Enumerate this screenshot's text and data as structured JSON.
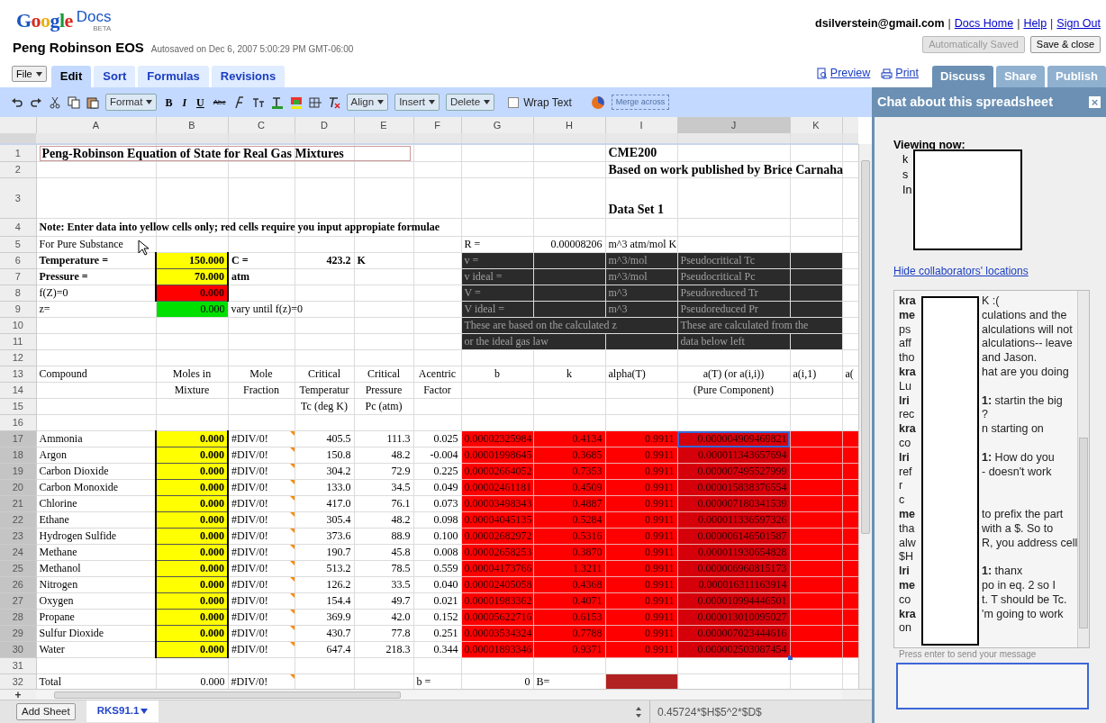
{
  "logo": {
    "wordmark": "Google",
    "product": "Docs",
    "badge": "BETA"
  },
  "document": {
    "title": "Peng Robinson EOS",
    "autosave": "Autosaved on Dec 6, 2007 5:00:29 PM GMT-06:00"
  },
  "account_bar": [
    {
      "text": "dsilverstein@gmail.com",
      "kind": "email"
    },
    {
      "text": "|",
      "kind": "separator"
    },
    {
      "text": "Docs Home",
      "kind": "link"
    },
    {
      "text": "|",
      "kind": "separator"
    },
    {
      "text": "Help",
      "kind": "link"
    },
    {
      "text": "|",
      "kind": "separator"
    },
    {
      "text": "Sign Out",
      "kind": "link"
    }
  ],
  "save_buttons": [
    {
      "label": "Automatically Saved",
      "disabled": true
    },
    {
      "label": "Save & close",
      "disabled": false
    }
  ],
  "file_menu": "File",
  "tabs": [
    {
      "label": "Edit",
      "selected": true
    },
    {
      "label": "Sort",
      "selected": false
    },
    {
      "label": "Formulas",
      "selected": false
    },
    {
      "label": "Revisions",
      "selected": false
    }
  ],
  "view_links": [
    {
      "label": "Preview"
    },
    {
      "label": "Print"
    }
  ],
  "panel_tabs": [
    {
      "label": "Discuss",
      "selected": true
    },
    {
      "label": "Share",
      "selected": false
    },
    {
      "label": "Publish",
      "selected": false
    }
  ],
  "toolbar": {
    "format": "Format",
    "bold": "B",
    "italic": "I",
    "underline": "U",
    "strikethrough": "Abc",
    "align": "Align",
    "insert": "Insert",
    "delete": "Delete",
    "wrap_text": {
      "label": "Wrap Text",
      "checked": false
    },
    "merge": {
      "label": "Merge across",
      "disabled": true
    }
  },
  "columns": [
    {
      "label": "A",
      "selected": false
    },
    {
      "label": "B",
      "selected": false
    },
    {
      "label": "C",
      "selected": false
    },
    {
      "label": "D",
      "selected": false
    },
    {
      "label": "E",
      "selected": false
    },
    {
      "label": "F",
      "selected": false
    },
    {
      "label": "G",
      "selected": false
    },
    {
      "label": "H",
      "selected": false
    },
    {
      "label": "I",
      "selected": false
    },
    {
      "label": "J",
      "selected": true
    },
    {
      "label": "K",
      "selected": false
    }
  ],
  "rows": [
    {
      "number": "1",
      "selected": false,
      "cells": {
        "A": {
          "text": "Peng-Robinson Equation of State for Real Gas Mixtures",
          "kind": "boxed_title"
        },
        "I": {
          "text": "CME200",
          "kind": "title"
        }
      }
    },
    {
      "number": "2",
      "selected": false,
      "cells": {
        "I": {
          "text": "Based on work published by Brice Carnaha",
          "kind": "title"
        }
      }
    },
    {
      "number": "3",
      "selected": false,
      "cells": {
        "I": {
          "text": "Data Set 1",
          "kind": "title"
        }
      }
    },
    {
      "number": "4",
      "selected": false,
      "cells": {
        "A": {
          "text": "Note: Enter data into yellow cells only; red cells require you input appropiate formulae",
          "kind": "bold"
        }
      }
    },
    {
      "number": "5",
      "selected": false,
      "cells": {
        "A": {
          "text": "For Pure Substance"
        },
        "G": {
          "text": "R ="
        },
        "H": {
          "text": "0.00008206"
        },
        "I": {
          "text": "m^3 atm/mol K"
        }
      }
    },
    {
      "number": "6",
      "selected": false,
      "cells": {
        "A": {
          "text": "Temperature =",
          "kind": "bold"
        },
        "B": {
          "text": "150.000",
          "kind": "input",
          "color": "#ffff00"
        },
        "C": {
          "text": "C =",
          "kind": "bold"
        },
        "D": {
          "text": "423.2",
          "kind": "bold"
        },
        "E": {
          "text": "K",
          "kind": "bold"
        },
        "G": {
          "text": "v =",
          "color": "#2b2b2b"
        },
        "H": {
          "color": "#2b2b2b"
        },
        "I": {
          "text": "m^3/mol",
          "color": "#2b2b2b"
        },
        "J": {
          "text": "Pseudocritical Tc",
          "color": "#2b2b2b"
        },
        "K": {
          "color": "#2b2b2b"
        }
      }
    },
    {
      "number": "7",
      "selected": false,
      "cells": {
        "A": {
          "text": "Pressure =",
          "kind": "bold"
        },
        "B": {
          "text": "70.000",
          "kind": "input",
          "color": "#ffff00"
        },
        "C": {
          "text": "atm",
          "kind": "bold"
        },
        "G": {
          "text": "v ideal =",
          "color": "#2b2b2b"
        },
        "H": {
          "color": "#2b2b2b"
        },
        "I": {
          "text": "m^3/mol",
          "color": "#2b2b2b"
        },
        "J": {
          "text": "Pseudocritical Pc",
          "color": "#2b2b2b"
        },
        "K": {
          "color": "#2b2b2b"
        }
      }
    },
    {
      "number": "8",
      "selected": false,
      "cells": {
        "A": {
          "text": "f(Z)=0"
        },
        "B": {
          "text": "0.000",
          "kind": "input",
          "color": "#ff0000"
        },
        "G": {
          "text": "V =",
          "color": "#2b2b2b"
        },
        "H": {
          "color": "#2b2b2b"
        },
        "I": {
          "text": "m^3",
          "color": "#2b2b2b"
        },
        "J": {
          "text": "Pseudoreduced Tr",
          "color": "#2b2b2b"
        },
        "K": {
          "color": "#2b2b2b"
        }
      }
    },
    {
      "number": "9",
      "selected": false,
      "cells": {
        "A": {
          "text": "z="
        },
        "B": {
          "text": "0.000",
          "color": "#00e000"
        },
        "C": {
          "text": "vary until f(z)=0"
        },
        "G": {
          "text": "V ideal =",
          "color": "#2b2b2b"
        },
        "H": {
          "color": "#2b2b2b"
        },
        "I": {
          "text": "m^3",
          "color": "#2b2b2b"
        },
        "J": {
          "text": "Pseudoreduced Pr",
          "color": "#2b2b2b"
        },
        "K": {
          "color": "#2b2b2b"
        }
      }
    },
    {
      "number": "10",
      "selected": false,
      "cells": {
        "G": {
          "text": "These are based on the calculated z",
          "color": "#2b2b2b"
        },
        "H": {
          "color": "#2b2b2b"
        },
        "I": {
          "color": "#2b2b2b"
        },
        "J": {
          "text": "These are calculated from the",
          "color": "#2b2b2b"
        },
        "K": {
          "color": "#2b2b2b"
        }
      }
    },
    {
      "number": "11",
      "selected": false,
      "cells": {
        "G": {
          "text": "or the ideal gas law",
          "color": "#2b2b2b"
        },
        "H": {
          "color": "#2b2b2b"
        },
        "I": {
          "color": "#2b2b2b"
        },
        "J": {
          "text": "data below left",
          "color": "#2b2b2b"
        },
        "K": {
          "color": "#2b2b2b"
        }
      }
    },
    {
      "number": "12",
      "selected": false,
      "cells": {}
    },
    {
      "number": "13",
      "selected": false,
      "cells": {
        "A": {
          "text": "Compound"
        },
        "B": {
          "text": "Moles in"
        },
        "C": {
          "text": "Mole"
        },
        "D": {
          "text": "Critical"
        },
        "E": {
          "text": "Critical"
        },
        "F": {
          "text": "Acentric"
        },
        "G": {
          "text": "b"
        },
        "H": {
          "text": "k"
        },
        "I": {
          "text": "alpha(T)"
        },
        "J": {
          "text": "a(T) (or a(i,i))"
        },
        "K": {
          "text": "a(i,1)"
        },
        "L": {
          "text": "a("
        }
      }
    },
    {
      "number": "14",
      "selected": false,
      "cells": {
        "B": {
          "text": "Mixture"
        },
        "C": {
          "text": "Fraction"
        },
        "D": {
          "text": "Temperatur"
        },
        "E": {
          "text": "Pressure"
        },
        "F": {
          "text": "Factor"
        },
        "J": {
          "text": "(Pure Component)"
        }
      }
    },
    {
      "number": "15",
      "selected": false,
      "cells": {
        "D": {
          "text": "Tc (deg K)"
        },
        "E": {
          "text": "Pc (atm)"
        }
      }
    },
    {
      "number": "16",
      "selected": false,
      "cells": {}
    },
    {
      "number": "17",
      "selected": true,
      "cells": {
        "A": {
          "text": "Ammonia"
        },
        "B": {
          "text": "0.000",
          "kind": "input",
          "color": "#ffff00"
        },
        "C": {
          "text": "#DIV/0!",
          "comment": true
        },
        "D": {
          "text": "405.5"
        },
        "E": {
          "text": "111.3"
        },
        "F": {
          "text": "0.025"
        },
        "G": {
          "text": "0.00002325984",
          "color": "#ff0000"
        },
        "H": {
          "text": "0.4134",
          "color": "#ff0000"
        },
        "I": {
          "text": "0.9911",
          "color": "#ff0000"
        },
        "J": {
          "text": "0.000004909469821",
          "color": "#ff0000"
        },
        "K": {
          "color": "#ff0000"
        },
        "L": {
          "color": "#ff0000"
        }
      }
    },
    {
      "number": "18",
      "selected": true,
      "cells": {
        "A": {
          "text": "Argon"
        },
        "B": {
          "text": "0.000",
          "kind": "input",
          "color": "#ffff00"
        },
        "C": {
          "text": "#DIV/0!",
          "comment": true
        },
        "D": {
          "text": "150.8"
        },
        "E": {
          "text": "48.2"
        },
        "F": {
          "text": "-0.004"
        },
        "G": {
          "text": "0.00001998645",
          "color": "#ff0000"
        },
        "H": {
          "text": "0.3685",
          "color": "#ff0000"
        },
        "I": {
          "text": "0.9911",
          "color": "#ff0000"
        },
        "J": {
          "text": "0.000011343657694",
          "color": "#ff0000"
        },
        "K": {
          "color": "#ff0000"
        },
        "L": {
          "color": "#ff0000"
        }
      }
    },
    {
      "number": "19",
      "selected": true,
      "cells": {
        "A": {
          "text": "Carbon Dioxide"
        },
        "B": {
          "text": "0.000",
          "kind": "input",
          "color": "#ffff00"
        },
        "C": {
          "text": "#DIV/0!",
          "comment": true
        },
        "D": {
          "text": "304.2"
        },
        "E": {
          "text": "72.9"
        },
        "F": {
          "text": "0.225"
        },
        "G": {
          "text": "0.00002664052",
          "color": "#ff0000"
        },
        "H": {
          "text": "0.7353",
          "color": "#ff0000"
        },
        "I": {
          "text": "0.9911",
          "color": "#ff0000"
        },
        "J": {
          "text": "0.000007495527999",
          "color": "#ff0000"
        },
        "K": {
          "color": "#ff0000"
        },
        "L": {
          "color": "#ff0000"
        }
      }
    },
    {
      "number": "20",
      "selected": true,
      "cells": {
        "A": {
          "text": "Carbon Monoxide"
        },
        "B": {
          "text": "0.000",
          "kind": "input",
          "color": "#ffff00"
        },
        "C": {
          "text": "#DIV/0!",
          "comment": true
        },
        "D": {
          "text": "133.0"
        },
        "E": {
          "text": "34.5"
        },
        "F": {
          "text": "0.049"
        },
        "G": {
          "text": "0.00002461181",
          "color": "#ff0000"
        },
        "H": {
          "text": "0.4509",
          "color": "#ff0000"
        },
        "I": {
          "text": "0.9911",
          "color": "#ff0000"
        },
        "J": {
          "text": "0.000015838376554",
          "color": "#ff0000"
        },
        "K": {
          "color": "#ff0000"
        },
        "L": {
          "color": "#ff0000"
        }
      }
    },
    {
      "number": "21",
      "selected": true,
      "cells": {
        "A": {
          "text": "Chlorine"
        },
        "B": {
          "text": "0.000",
          "kind": "input",
          "color": "#ffff00"
        },
        "C": {
          "text": "#DIV/0!",
          "comment": true
        },
        "D": {
          "text": "417.0"
        },
        "E": {
          "text": "76.1"
        },
        "F": {
          "text": "0.073"
        },
        "G": {
          "text": "0.00003498343",
          "color": "#ff0000"
        },
        "H": {
          "text": "0.4887",
          "color": "#ff0000"
        },
        "I": {
          "text": "0.9911",
          "color": "#ff0000"
        },
        "J": {
          "text": "0.000007180341539",
          "color": "#ff0000"
        },
        "K": {
          "color": "#ff0000"
        },
        "L": {
          "color": "#ff0000"
        }
      }
    },
    {
      "number": "22",
      "selected": true,
      "cells": {
        "A": {
          "text": "Ethane"
        },
        "B": {
          "text": "0.000",
          "kind": "input",
          "color": "#ffff00"
        },
        "C": {
          "text": "#DIV/0!",
          "comment": true
        },
        "D": {
          "text": "305.4"
        },
        "E": {
          "text": "48.2"
        },
        "F": {
          "text": "0.098"
        },
        "G": {
          "text": "0.00004045135",
          "color": "#ff0000"
        },
        "H": {
          "text": "0.5284",
          "color": "#ff0000"
        },
        "I": {
          "text": "0.9911",
          "color": "#ff0000"
        },
        "J": {
          "text": "0.000011336597326",
          "color": "#ff0000"
        },
        "K": {
          "color": "#ff0000"
        },
        "L": {
          "color": "#ff0000"
        }
      }
    },
    {
      "number": "23",
      "selected": true,
      "cells": {
        "A": {
          "text": "Hydrogen Sulfide"
        },
        "B": {
          "text": "0.000",
          "kind": "input",
          "color": "#ffff00"
        },
        "C": {
          "text": "#DIV/0!",
          "comment": true
        },
        "D": {
          "text": "373.6"
        },
        "E": {
          "text": "88.9"
        },
        "F": {
          "text": "0.100"
        },
        "G": {
          "text": "0.00002682972",
          "color": "#ff0000"
        },
        "H": {
          "text": "0.5316",
          "color": "#ff0000"
        },
        "I": {
          "text": "0.9911",
          "color": "#ff0000"
        },
        "J": {
          "text": "0.000006146501587",
          "color": "#ff0000"
        },
        "K": {
          "color": "#ff0000"
        },
        "L": {
          "color": "#ff0000"
        }
      }
    },
    {
      "number": "24",
      "selected": true,
      "cells": {
        "A": {
          "text": "Methane"
        },
        "B": {
          "text": "0.000",
          "kind": "input",
          "color": "#ffff00"
        },
        "C": {
          "text": "#DIV/0!",
          "comment": true
        },
        "D": {
          "text": "190.7"
        },
        "E": {
          "text": "45.8"
        },
        "F": {
          "text": "0.008"
        },
        "G": {
          "text": "0.00002658253",
          "color": "#ff0000"
        },
        "H": {
          "text": "0.3870",
          "color": "#ff0000"
        },
        "I": {
          "text": "0.9911",
          "color": "#ff0000"
        },
        "J": {
          "text": "0.000011930654828",
          "color": "#ff0000"
        },
        "K": {
          "color": "#ff0000"
        },
        "L": {
          "color": "#ff0000"
        }
      }
    },
    {
      "number": "25",
      "selected": true,
      "cells": {
        "A": {
          "text": "Methanol"
        },
        "B": {
          "text": "0.000",
          "kind": "input",
          "color": "#ffff00"
        },
        "C": {
          "text": "#DIV/0!",
          "comment": true
        },
        "D": {
          "text": "513.2"
        },
        "E": {
          "text": "78.5"
        },
        "F": {
          "text": "0.559"
        },
        "G": {
          "text": "0.00004173766",
          "color": "#ff0000"
        },
        "H": {
          "text": "1.3211",
          "color": "#ff0000"
        },
        "I": {
          "text": "0.9911",
          "color": "#ff0000"
        },
        "J": {
          "text": "0.000006960815173",
          "color": "#ff0000"
        },
        "K": {
          "color": "#ff0000"
        },
        "L": {
          "color": "#ff0000"
        }
      }
    },
    {
      "number": "26",
      "selected": true,
      "cells": {
        "A": {
          "text": "Nitrogen"
        },
        "B": {
          "text": "0.000",
          "kind": "input",
          "color": "#ffff00"
        },
        "C": {
          "text": "#DIV/0!",
          "comment": true
        },
        "D": {
          "text": "126.2"
        },
        "E": {
          "text": "33.5"
        },
        "F": {
          "text": "0.040"
        },
        "G": {
          "text": "0.00002405058",
          "color": "#ff0000"
        },
        "H": {
          "text": "0.4368",
          "color": "#ff0000"
        },
        "I": {
          "text": "0.9911",
          "color": "#ff0000"
        },
        "J": {
          "text": "0.000016311163914",
          "color": "#ff0000"
        },
        "K": {
          "color": "#ff0000"
        },
        "L": {
          "color": "#ff0000"
        }
      }
    },
    {
      "number": "27",
      "selected": true,
      "cells": {
        "A": {
          "text": "Oxygen"
        },
        "B": {
          "text": "0.000",
          "kind": "input",
          "color": "#ffff00"
        },
        "C": {
          "text": "#DIV/0!",
          "comment": true
        },
        "D": {
          "text": "154.4"
        },
        "E": {
          "text": "49.7"
        },
        "F": {
          "text": "0.021"
        },
        "G": {
          "text": "0.00001983362",
          "color": "#ff0000"
        },
        "H": {
          "text": "0.4071",
          "color": "#ff0000"
        },
        "I": {
          "text": "0.9911",
          "color": "#ff0000"
        },
        "J": {
          "text": "0.000010994446501",
          "color": "#ff0000"
        },
        "K": {
          "color": "#ff0000"
        },
        "L": {
          "color": "#ff0000"
        }
      }
    },
    {
      "number": "28",
      "selected": true,
      "cells": {
        "A": {
          "text": "Propane"
        },
        "B": {
          "text": "0.000",
          "kind": "input",
          "color": "#ffff00"
        },
        "C": {
          "text": "#DIV/0!",
          "comment": true
        },
        "D": {
          "text": "369.9"
        },
        "E": {
          "text": "42.0"
        },
        "F": {
          "text": "0.152"
        },
        "G": {
          "text": "0.00005622716",
          "color": "#ff0000"
        },
        "H": {
          "text": "0.6153",
          "color": "#ff0000"
        },
        "I": {
          "text": "0.9911",
          "color": "#ff0000"
        },
        "J": {
          "text": "0.000013010095027",
          "color": "#ff0000"
        },
        "K": {
          "color": "#ff0000"
        },
        "L": {
          "color": "#ff0000"
        }
      }
    },
    {
      "number": "29",
      "selected": true,
      "cells": {
        "A": {
          "text": "Sulfur Dioxide"
        },
        "B": {
          "text": "0.000",
          "kind": "input",
          "color": "#ffff00"
        },
        "C": {
          "text": "#DIV/0!",
          "comment": true
        },
        "D": {
          "text": "430.7"
        },
        "E": {
          "text": "77.8"
        },
        "F": {
          "text": "0.251"
        },
        "G": {
          "text": "0.00003534324",
          "color": "#ff0000"
        },
        "H": {
          "text": "0.7788",
          "color": "#ff0000"
        },
        "I": {
          "text": "0.9911",
          "color": "#ff0000"
        },
        "J": {
          "text": "0.000007023444616",
          "color": "#ff0000"
        },
        "K": {
          "color": "#ff0000"
        },
        "L": {
          "color": "#ff0000"
        }
      }
    },
    {
      "number": "30",
      "selected": true,
      "cells": {
        "A": {
          "text": "Water"
        },
        "B": {
          "text": "0.000",
          "kind": "input",
          "color": "#ffff00"
        },
        "C": {
          "text": "#DIV/0!",
          "comment": true
        },
        "D": {
          "text": "647.4"
        },
        "E": {
          "text": "218.3"
        },
        "F": {
          "text": "0.344"
        },
        "G": {
          "text": "0.00001893346",
          "color": "#ff0000"
        },
        "H": {
          "text": "0.9371",
          "color": "#ff0000"
        },
        "I": {
          "text": "0.9911",
          "color": "#ff0000"
        },
        "J": {
          "text": "0.000002503087454",
          "color": "#ff0000"
        },
        "K": {
          "color": "#ff0000"
        },
        "L": {
          "color": "#ff0000"
        }
      }
    },
    {
      "number": "31",
      "selected": false,
      "cells": {}
    },
    {
      "number": "32",
      "selected": false,
      "cells": {
        "A": {
          "text": "Total"
        },
        "B": {
          "text": "0.000"
        },
        "C": {
          "text": "#DIV/0!",
          "comment": true
        },
        "F": {
          "text": "b ="
        },
        "G": {
          "text": "0"
        },
        "H": {
          "text": "B="
        },
        "I": {
          "color": "#b22222"
        }
      }
    }
  ],
  "add_row": "+",
  "add_sheet": "Add Sheet",
  "sheet_tabs": [
    {
      "label": "RKS91.1",
      "selected": true
    }
  ],
  "formula_preview": "0.45724*$H$5^2*$D$",
  "chat": {
    "title": "Chat about this spreadsheet",
    "close": "×",
    "viewing_label": "Viewing now:",
    "viewers": [
      "k",
      "s",
      "In"
    ],
    "hide_link": "Hide collaborators' locations",
    "lines": [
      {
        "start": "kra",
        "author": true,
        "end": "K :("
      },
      {
        "start": "me",
        "author": true,
        "end": "culations and the"
      },
      {
        "start": "ps",
        "author": false,
        "end": "alculations will not"
      },
      {
        "start": "aff",
        "author": false,
        "end": "alculations-- leave"
      },
      {
        "start": "tho",
        "author": false,
        "end": "and Jason."
      },
      {
        "start": "kra",
        "author": true,
        "end": "hat are you doing"
      },
      {
        "start": "Lu",
        "author": false
      },
      {
        "start": "lri",
        "author": true,
        "end": "**1:** startin the big"
      },
      {
        "start": "rec",
        "author": false,
        "end": "?"
      },
      {
        "start": "kra",
        "author": true,
        "end": "n starting on"
      },
      {
        "start": "co",
        "author": false
      },
      {
        "start": "lri",
        "author": true,
        "end": "**1:** How do you"
      },
      {
        "start": "ref",
        "author": false,
        "end": "- doesn't work"
      },
      {
        "start": "r",
        "author": false
      },
      {
        "start": "c",
        "author": false
      },
      {
        "start": "me",
        "author": true,
        "end": "to prefix the part"
      },
      {
        "start": "tha",
        "author": false,
        "end": "with a $. So to"
      },
      {
        "start": "alw",
        "author": false,
        "end": "R, you address cell"
      },
      {
        "start": "$H",
        "author": false
      },
      {
        "start": "lri",
        "author": true,
        "end": "**1:** thanx"
      },
      {
        "start": "me",
        "author": true,
        "end": "po in eq. 2 so I"
      },
      {
        "start": "co",
        "author": false,
        "end": "t. T should be Tc."
      },
      {
        "start": "kra",
        "author": true,
        "end": "'m going to work"
      },
      {
        "start": "on",
        "author": false
      }
    ],
    "input_hint": "Press enter to send your message"
  }
}
